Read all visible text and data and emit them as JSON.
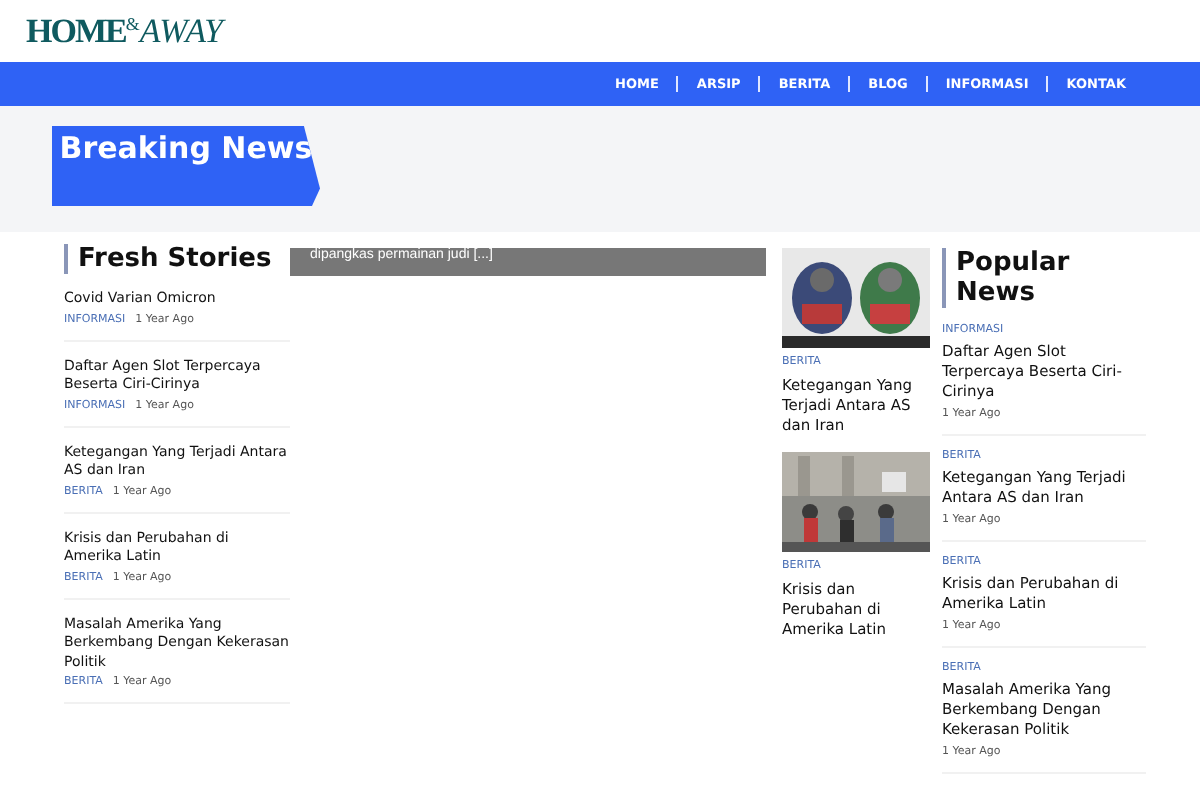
{
  "logo": {
    "parts": [
      "HOME",
      "&",
      "AWAY"
    ]
  },
  "nav": {
    "items": [
      {
        "label": "HOME"
      },
      {
        "label": "ARSIP"
      },
      {
        "label": "BERITA"
      },
      {
        "label": "BLOG"
      },
      {
        "label": "INFORMASI"
      },
      {
        "label": "KONTAK"
      }
    ]
  },
  "breaking": {
    "title": "Breaking News",
    "ticker": "dipangkas permainan judi [...]"
  },
  "fresh": {
    "title": "Fresh Stories",
    "items": [
      {
        "title": "Covid Varian Omicron",
        "category": "INFORMASI",
        "time": "1 Year Ago"
      },
      {
        "title": "Daftar Agen Slot Terpercaya Beserta Ciri-Cirinya",
        "category": "INFORMASI",
        "time": "1 Year Ago"
      },
      {
        "title": "Ketegangan Yang Terjadi Antara AS dan Iran",
        "category": "BERITA",
        "time": "1 Year Ago"
      },
      {
        "title": "Krisis dan Perubahan di Amerika Latin",
        "category": "BERITA",
        "time": "1 Year Ago"
      },
      {
        "title": "Masalah Amerika Yang Berkembang Dengan Kekerasan Politik",
        "category": "BERITA",
        "time": "1 Year Ago"
      }
    ]
  },
  "featured": {
    "items": [
      {
        "kind": "picture",
        "category": "BERITA",
        "title": "Ketegangan Yang Terjadi Antara AS dan Iran"
      },
      {
        "kind": "picture",
        "category": "BERITA",
        "title": "Krisis dan Perubahan di Amerika Latin"
      }
    ]
  },
  "popular": {
    "title": "Popular News",
    "items": [
      {
        "category": "INFORMASI",
        "title": "Daftar Agen Slot Terpercaya Beserta Ciri-Cirinya",
        "time": "1 Year Ago"
      },
      {
        "category": "BERITA",
        "title": "Ketegangan Yang Terjadi Antara AS dan Iran",
        "time": "1 Year Ago"
      },
      {
        "category": "BERITA",
        "title": "Krisis dan Perubahan di Amerika Latin",
        "time": "1 Year Ago"
      },
      {
        "category": "BERITA",
        "title": "Masalah Amerika Yang Berkembang Dengan Kekerasan Politik",
        "time": "1 Year Ago"
      }
    ]
  }
}
